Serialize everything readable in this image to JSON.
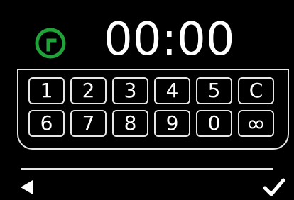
{
  "timer": {
    "icon": "timer-icon",
    "icon_color": "#22a33a",
    "display": "00:00"
  },
  "keypad": {
    "keys": [
      "1",
      "2",
      "3",
      "4",
      "5",
      "C",
      "6",
      "7",
      "8",
      "9",
      "0",
      "∞"
    ]
  },
  "footer": {
    "back_icon": "back-arrow-icon",
    "confirm_icon": "checkmark-icon"
  },
  "colors": {
    "background": "#000000",
    "foreground": "#ffffff",
    "accent": "#22a33a"
  }
}
